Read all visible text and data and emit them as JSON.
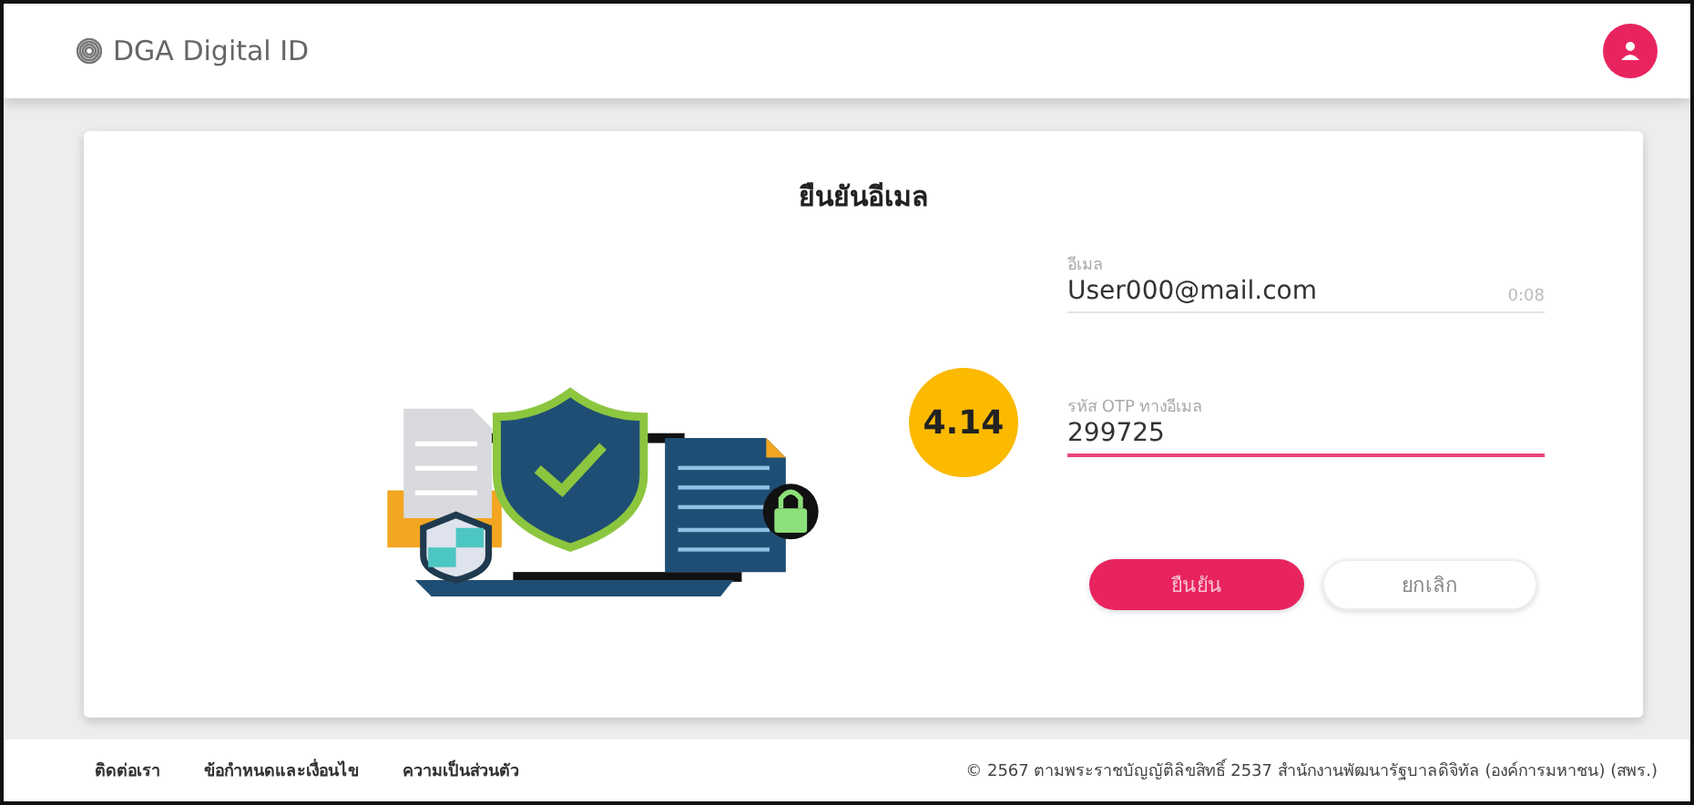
{
  "header": {
    "brand": "DGA Digital ID"
  },
  "card": {
    "title": "ยืนยันอีเมล",
    "fields": [
      {
        "label": "อีเมล",
        "value": "User000@mail.com",
        "timer": "0:08",
        "focused": false
      },
      {
        "label": "รหัส OTP ทางอีเมล",
        "value": "299725",
        "focused": true
      }
    ],
    "buttons": [
      {
        "label": "ยืนยัน",
        "kind": "primary"
      },
      {
        "label": "ยกเลิก",
        "kind": "secondary"
      }
    ]
  },
  "badge": "4.14",
  "footer": {
    "links": [
      "ติดต่อเรา",
      "ข้อกำหนดและเงื่อนไข",
      "ความเป็นส่วนตัว"
    ],
    "copyright": "© 2567 ตามพระราชบัญญัติลิขสิทธิ์ 2537 สำนักงานพัฒนารัฐบาลดิจิทัล (องค์การมหาชน) (สพร.)"
  }
}
